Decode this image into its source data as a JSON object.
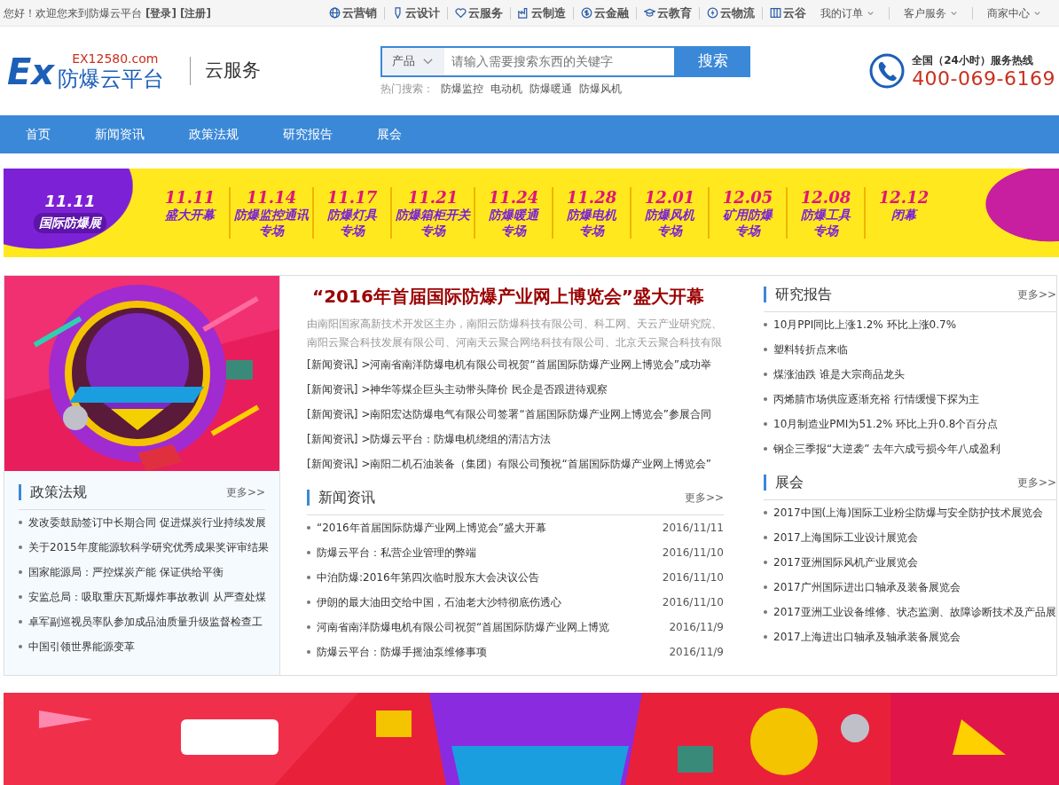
{
  "top_bar": {
    "greeting": "您好！欢迎您来到防爆云平台",
    "links": [
      "[登录]",
      "[注册]"
    ],
    "services": [
      "云营销",
      "云设计",
      "云服务",
      "云制造",
      "云金融",
      "云教育",
      "云物流",
      "云谷"
    ],
    "menus": [
      "我的订单",
      "客户服务",
      "商家中心"
    ]
  },
  "header": {
    "logo_mark": "Ex",
    "logo_domain": "EX12580.com",
    "logo_text": "防爆云平台",
    "section": "云服务",
    "search": {
      "category": "产品",
      "placeholder": "请输入需要搜索东西的关键字",
      "button": "搜索",
      "hot_label": "热门搜索：",
      "hot": [
        "防爆监控",
        "电动机",
        "防爆暖通",
        "防爆风机"
      ]
    },
    "hotline": {
      "label": "全国（24小时）服务热线",
      "number": "400-069-6169"
    }
  },
  "nav": [
    "首页",
    "新闻资讯",
    "政策法规",
    "研究报告",
    "展会"
  ],
  "promo_strip": {
    "badge_number": "11.11",
    "badge_text": "国际防爆展",
    "items": [
      {
        "date": "11.11",
        "lines": [
          "盛大开幕"
        ]
      },
      {
        "date": "11.14",
        "lines": [
          "防爆监控通讯",
          "专场"
        ]
      },
      {
        "date": "11.17",
        "lines": [
          "防爆灯具",
          "专场"
        ]
      },
      {
        "date": "11.21",
        "lines": [
          "防爆箱柜开关",
          "专场"
        ]
      },
      {
        "date": "11.24",
        "lines": [
          "防爆暖通",
          "专场"
        ]
      },
      {
        "date": "11.28",
        "lines": [
          "防爆电机",
          "专场"
        ]
      },
      {
        "date": "12.01",
        "lines": [
          "防爆风机",
          "专场"
        ]
      },
      {
        "date": "12.05",
        "lines": [
          "矿用防爆",
          "专场"
        ]
      },
      {
        "date": "12.08",
        "lines": [
          "防爆工具",
          "专场"
        ]
      },
      {
        "date": "12.12",
        "lines": [
          "闭幕"
        ]
      }
    ]
  },
  "feature": {
    "picture": {
      "kind": "picture"
    },
    "headline": "“2016年首届国际防爆产业网上博览会”盛大开幕",
    "summary": [
      "由南阳国家高新技术开发区主办，南阳云防爆科技有限公司、科工网、天云产业研究院、",
      "南阳云聚合科技发展有限公司、河南天云聚合网络科技有限公司、北京天云聚合科技有限"
    ],
    "items": [
      {
        "tag": "[新闻资讯]",
        "title": ">河南省南洋防爆电机有限公司祝贺“首届国际防爆产业网上博览会”成功举"
      },
      {
        "tag": "[新闻资讯]",
        "title": ">神华等煤企巨头主动带头降价 民企是否跟进待观察"
      },
      {
        "tag": "[新闻资讯]",
        "title": ">南阳宏达防爆电气有限公司签署“首届国际防爆产业网上博览会”参展合同"
      },
      {
        "tag": "[新闻资讯]",
        "title": ">防爆云平台：防爆电机绕组的清洁方法"
      },
      {
        "tag": "[新闻资讯]",
        "title": ">南阳二机石油装备（集团）有限公司预祝“首届国际防爆产业网上博览会”"
      }
    ]
  },
  "research": {
    "title": "研究报告",
    "more": "更多>>",
    "items": [
      "10月PPI同比上涨1.2% 环比上涨0.7%",
      "塑料转折点来临",
      "煤涨油跌 谁是大宗商品龙头",
      "丙烯腈市场供应逐渐充裕 行情缓慢下探为主",
      "10月制造业PMI为51.2% 环比上升0.8个百分点",
      "钢企三季报“大逆袭” 去年六成亏损今年八成盈利"
    ]
  },
  "policy": {
    "title": "政策法规",
    "more": "更多>>",
    "items": [
      "发改委鼓励签订中长期合同 促进煤炭行业持续发展",
      "关于2015年度能源软科学研究优秀成果奖评审结果",
      "国家能源局：严控煤炭产能 保证供给平衡",
      "安监总局：吸取重庆瓦斯爆炸事故教训 从严查处煤",
      "卓军副巡视员率队参加成品油质量升级监督检查工",
      "中国引领世界能源变革"
    ]
  },
  "news": {
    "title": "新闻资讯",
    "more": "更多>>",
    "items": [
      {
        "title": "“2016年首届国际防爆产业网上博览会”盛大开幕",
        "date": "2016/11/11"
      },
      {
        "title": "防爆云平台：私营企业管理的弊端",
        "date": "2016/11/10"
      },
      {
        "title": "中泊防爆:2016年第四次临时股东大会决议公告",
        "date": "2016/11/10"
      },
      {
        "title": "伊朗的最大油田交给中国，石油老大沙特彻底伤透心",
        "date": "2016/11/10"
      },
      {
        "title": "河南省南洋防爆电机有限公司祝贺“首届国际防爆产业网上博览",
        "date": "2016/11/9"
      },
      {
        "title": "防爆云平台：防爆手摇油泵维修事项",
        "date": "2016/11/9"
      }
    ]
  },
  "expo": {
    "title": "展会",
    "more": "更多>>",
    "items": [
      "2017中国(上海)国际工业粉尘防爆与安全防护技术展览会",
      "2017上海国际工业设计展览会",
      "2017亚洲国际风机产业展览会",
      "2017广州国际进出口轴承及装备展览会",
      "2017亚洲工业设备维修、状态监测、故障诊断技术及产品展",
      "2017上海进出口轴承及轴承装备展览会"
    ]
  },
  "bottom_banner": {
    "kind": "picture"
  }
}
